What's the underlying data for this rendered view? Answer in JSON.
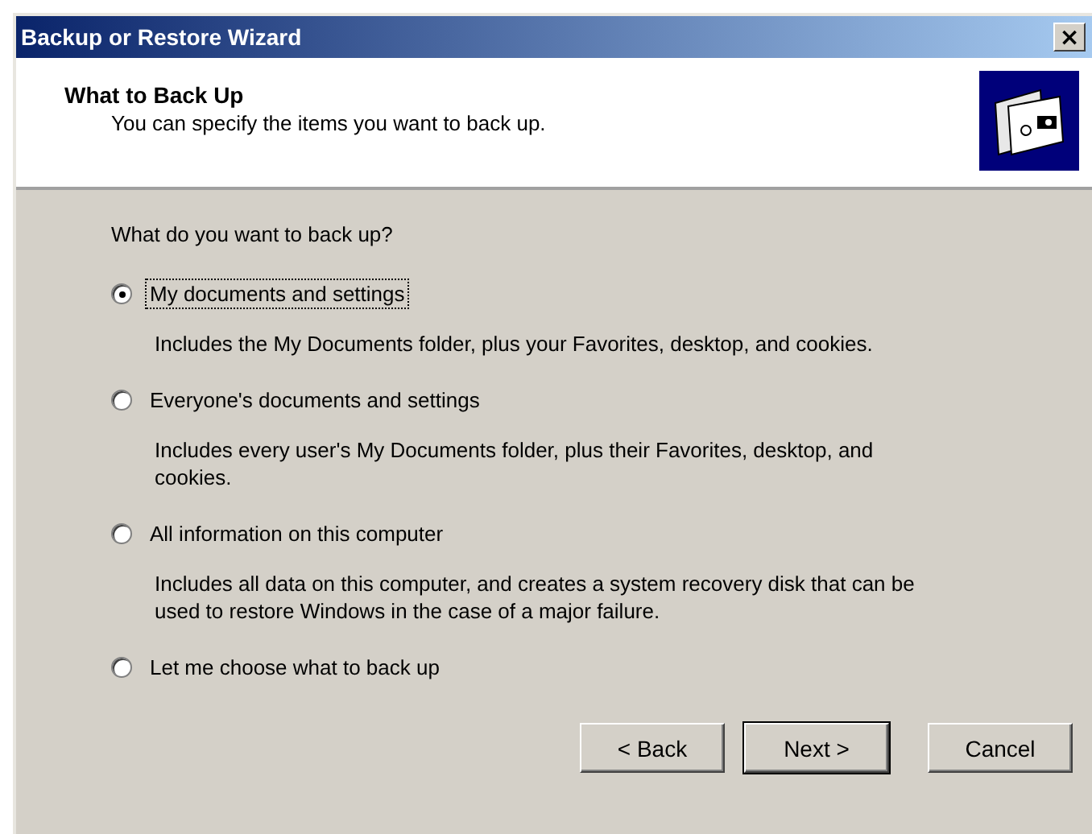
{
  "window": {
    "title": "Backup or Restore Wizard",
    "close_label": "×"
  },
  "header": {
    "title": "What to Back Up",
    "subtitle": "You can specify the items you want to back up."
  },
  "question": "What do you want to back up?",
  "options": [
    {
      "label": "My documents and settings",
      "selected": true,
      "description": "Includes the My Documents folder, plus your Favorites, desktop, and cookies."
    },
    {
      "label": "Everyone's documents and settings",
      "selected": false,
      "description": "Includes every user's My Documents folder, plus their Favorites, desktop, and cookies."
    },
    {
      "label": "All information on this computer",
      "selected": false,
      "description": "Includes all data on this computer, and creates a system recovery disk that can be used to restore Windows in the case of a major failure."
    },
    {
      "label": "Let me choose what to back up",
      "selected": false
    }
  ],
  "buttons": [
    {
      "label": "< Back",
      "default": false
    },
    {
      "label": "Next >",
      "default": true
    },
    {
      "label": "Cancel",
      "default": false
    }
  ]
}
